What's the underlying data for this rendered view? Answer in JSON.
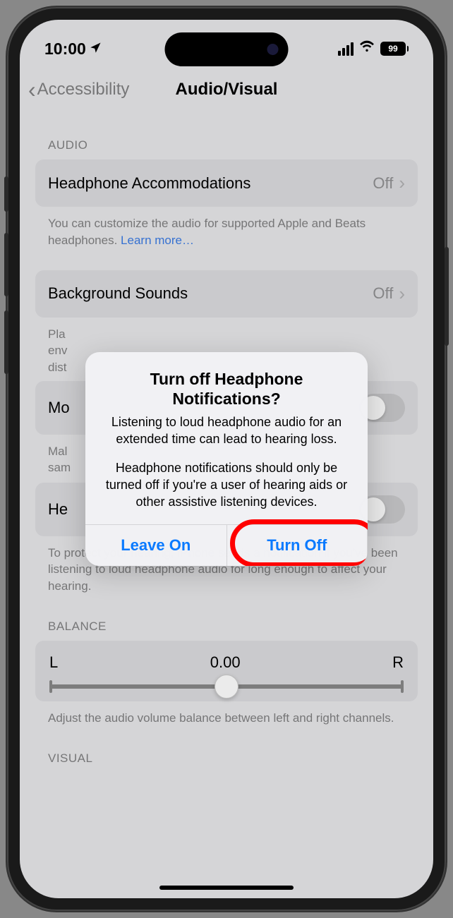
{
  "statusbar": {
    "time": "10:00",
    "battery_pct": "99"
  },
  "nav": {
    "back_label": "Accessibility",
    "title": "Audio/Visual"
  },
  "sections": {
    "audio_header": "AUDIO",
    "headphone_accom": {
      "label": "Headphone Accommodations",
      "value": "Off"
    },
    "headphone_accom_footer": "You can customize the audio for supported Apple and Beats headphones. ",
    "headphone_accom_link": "Learn more…",
    "background_sounds": {
      "label": "Background Sounds",
      "value": "Off"
    },
    "background_sounds_footer_partial": "Pla                                                                          e env dist",
    "mono_row_partial": "Mo",
    "mono_footer_partial": "Mal sam",
    "headphone_notif_row_partial": "He",
    "headphone_notif_footer": "To protect your hearing, iPhone sends a notification if you've been listening to loud headphone audio for long enough to affect your hearing.",
    "balance_header": "BALANCE",
    "balance": {
      "left": "L",
      "value": "0.00",
      "right": "R"
    },
    "balance_footer": "Adjust the audio volume balance between left and right channels.",
    "visual_header": "VISUAL"
  },
  "alert": {
    "title": "Turn off Headphone Notifications?",
    "message1": "Listening to loud headphone audio for an extended time can lead to hearing loss.",
    "message2": "Headphone notifications should only be turned off if you're a user of hearing aids or other assistive listening devices.",
    "leave_on": "Leave On",
    "turn_off": "Turn Off"
  }
}
